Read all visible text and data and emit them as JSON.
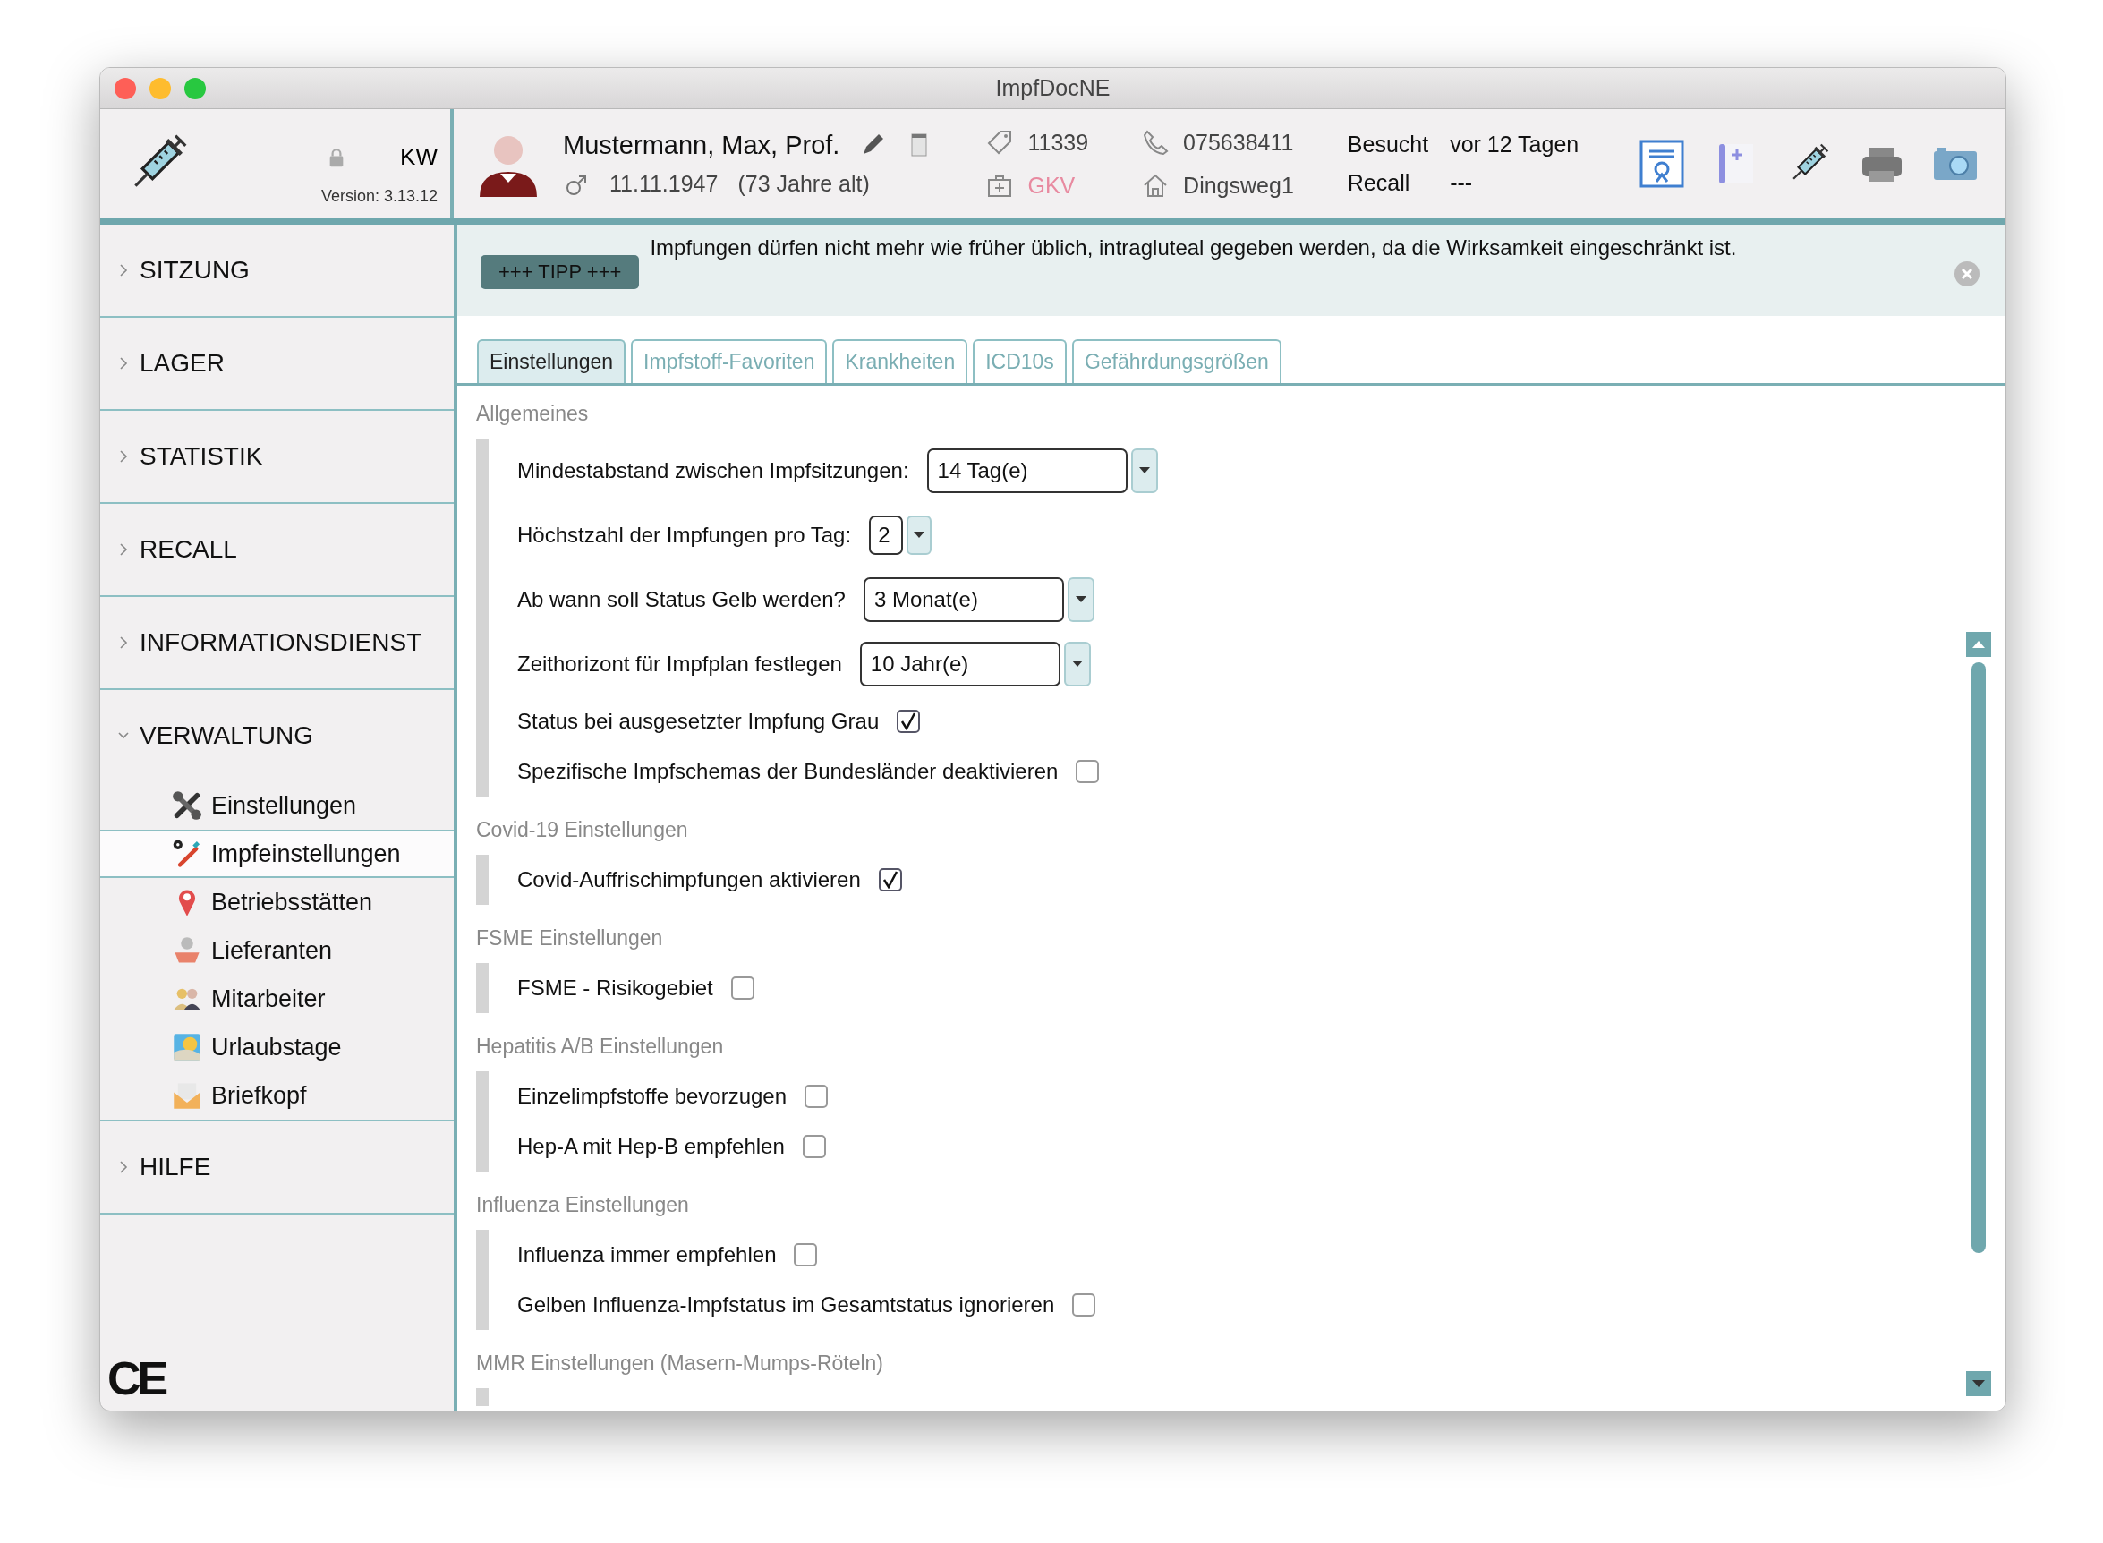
{
  "window": {
    "title": "ImpfDocNE"
  },
  "header": {
    "user": "KW",
    "version": "Version: 3.13.12",
    "patient": {
      "name": "Mustermann, Max, Prof.",
      "birth_date": "11.11.1947",
      "age": "(73 Jahre alt)",
      "number": "11339",
      "insurance": "GKV",
      "phone": "075638411",
      "street": "Dingsweg1"
    },
    "visits": [
      {
        "label": "Besucht",
        "value": "vor 12 Tagen"
      },
      {
        "label": "Recall",
        "value": "---"
      }
    ]
  },
  "sidebar": {
    "items": [
      {
        "label": "SITZUNG",
        "expanded": false
      },
      {
        "label": "LAGER",
        "expanded": false
      },
      {
        "label": "STATISTIK",
        "expanded": false
      },
      {
        "label": "RECALL",
        "expanded": false
      },
      {
        "label": "INFORMATIONSDIENST",
        "expanded": false
      },
      {
        "label": "VERWALTUNG",
        "expanded": true,
        "children": [
          {
            "label": "Einstellungen",
            "selected": false
          },
          {
            "label": "Impfeinstellungen",
            "selected": true
          },
          {
            "label": "Betriebsstätten",
            "selected": false
          },
          {
            "label": "Lieferanten",
            "selected": false
          },
          {
            "label": "Mitarbeiter",
            "selected": false
          },
          {
            "label": "Urlaubstage",
            "selected": false
          },
          {
            "label": "Briefkopf",
            "selected": false
          }
        ]
      },
      {
        "label": "HILFE",
        "expanded": false
      }
    ],
    "ce_mark": "CE"
  },
  "tip": {
    "badge": "+++ TIPP +++",
    "text": "Impfungen dürfen nicht mehr wie früher üblich, intragluteal gegeben werden, da die Wirksamkeit eingeschränkt ist."
  },
  "tabs": [
    {
      "label": "Einstellungen",
      "selected": true
    },
    {
      "label": "Impfstoff-Favoriten",
      "selected": false
    },
    {
      "label": "Krankheiten",
      "selected": false
    },
    {
      "label": "ICD10s",
      "selected": false
    },
    {
      "label": "Gefährdungsgrößen",
      "selected": false
    }
  ],
  "sections": [
    {
      "title": "Allgemeines",
      "rows": [
        {
          "kind": "select",
          "label": "Mindestabstand zwischen Impfsitzungen:",
          "value": "14 Tag(e)"
        },
        {
          "kind": "spinner",
          "label": "Höchstzahl der Impfungen pro Tag:",
          "value": "2"
        },
        {
          "kind": "select",
          "label": "Ab wann soll Status Gelb werden?",
          "value": "3 Monat(e)"
        },
        {
          "kind": "select",
          "label": "Zeithorizont für Impfplan festlegen",
          "value": "10 Jahr(e)"
        },
        {
          "kind": "checkbox",
          "label": "Status bei ausgesetzter Impfung Grau",
          "checked": true
        },
        {
          "kind": "checkbox",
          "label": "Spezifische Impfschemas der Bundesländer deaktivieren",
          "checked": false
        }
      ]
    },
    {
      "title": "Covid-19 Einstellungen",
      "rows": [
        {
          "kind": "checkbox",
          "label": "Covid-Auffrischimpfungen aktivieren",
          "checked": true
        }
      ]
    },
    {
      "title": "FSME Einstellungen",
      "rows": [
        {
          "kind": "checkbox",
          "label": "FSME - Risikogebiet",
          "checked": false
        }
      ]
    },
    {
      "title": "Hepatitis A/B Einstellungen",
      "rows": [
        {
          "kind": "checkbox",
          "label": "Einzelimpfstoffe bevorzugen",
          "checked": false
        },
        {
          "kind": "checkbox",
          "label": "Hep-A mit Hep-B empfehlen",
          "checked": false
        }
      ]
    },
    {
      "title": "Influenza Einstellungen",
      "rows": [
        {
          "kind": "checkbox",
          "label": "Influenza immer empfehlen",
          "checked": false
        },
        {
          "kind": "checkbox",
          "label": "Gelben Influenza-Impfstatus im Gesamtstatus ignorieren",
          "checked": false
        }
      ]
    },
    {
      "title": "MMR Einstellungen (Masern-Mumps-Röteln)"
    }
  ]
}
